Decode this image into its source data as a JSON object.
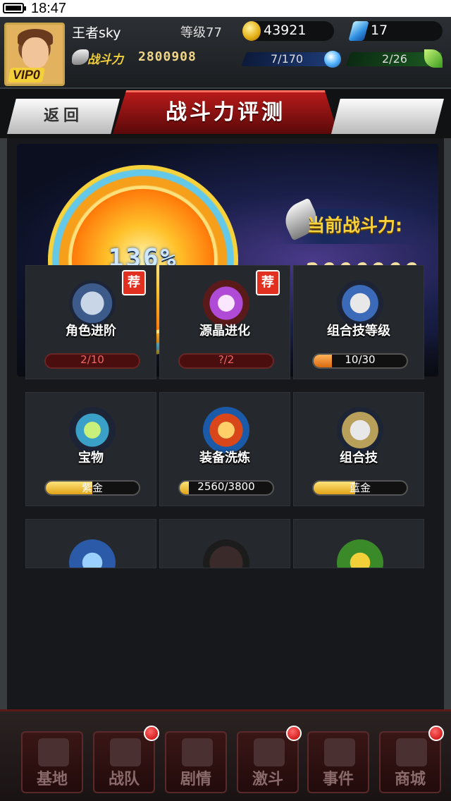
{
  "status_bar": {
    "time": "18:47"
  },
  "player": {
    "name": "王者sky",
    "level": "等级77",
    "vip": "VIP0",
    "power_label": "战斗力",
    "power_value": "2800908"
  },
  "resources": {
    "gold": "43921",
    "gems": "17",
    "stamina": "7/170",
    "energy": "2/26"
  },
  "nav": {
    "back_label": "返回",
    "title": "战斗力评测"
  },
  "hero": {
    "percent": "136%",
    "current_label": "当前战斗力:",
    "current_value": "2800908"
  },
  "features": [
    {
      "label": "角色进阶",
      "progress": "2/10",
      "recommended": true,
      "rec_label": "荐",
      "fill": 0.0
    },
    {
      "label": "源晶进化",
      "progress": "?/2",
      "recommended": true,
      "rec_label": "荐",
      "fill": 0.0
    },
    {
      "label": "组合技等级",
      "progress": "10/30",
      "recommended": false,
      "fill": 0.2
    },
    {
      "label": "宝物",
      "progress": "紫金",
      "recommended": false,
      "fill": 0.5
    },
    {
      "label": "装备洗炼",
      "progress": "2560/3800",
      "recommended": false,
      "fill": 0.1
    },
    {
      "label": "组合技",
      "progress": "蓝金",
      "recommended": false,
      "fill": 0.45
    }
  ],
  "bottom_nav": [
    {
      "label": "基地",
      "badge": false
    },
    {
      "label": "战队",
      "badge": true
    },
    {
      "label": "剧情",
      "badge": false
    },
    {
      "label": "激斗",
      "badge": true
    },
    {
      "label": "事件",
      "badge": false
    },
    {
      "label": "商城",
      "badge": true
    }
  ],
  "colors": {
    "accent_gold": "#f7d23a",
    "title_red": "#b71a1a",
    "badge_red": "#e23020"
  }
}
